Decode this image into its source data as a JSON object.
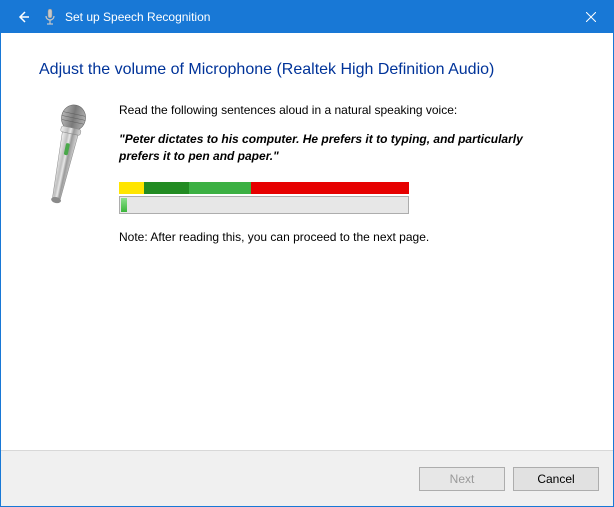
{
  "titlebar": {
    "title": "Set up Speech Recognition"
  },
  "main": {
    "heading": "Adjust the volume of Microphone (Realtek High Definition Audio)",
    "instruction": "Read the following sentences aloud in a natural speaking voice:",
    "sample": "\"Peter dictates to his computer. He prefers it to typing, and particularly prefers it to pen and paper.\"",
    "note": "Note: After reading this, you can proceed to the next page."
  },
  "footer": {
    "next": "Next",
    "cancel": "Cancel"
  }
}
